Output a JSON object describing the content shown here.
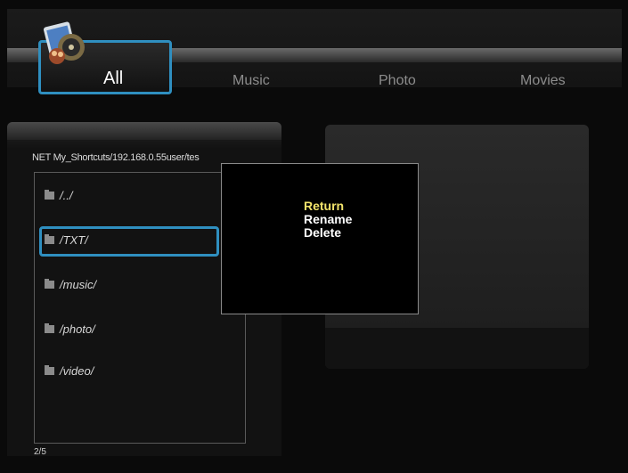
{
  "tabs": [
    {
      "label": "All",
      "active": true
    },
    {
      "label": "Music",
      "active": false
    },
    {
      "label": "Photo",
      "active": false
    },
    {
      "label": "Movies",
      "active": false
    }
  ],
  "browser": {
    "path": "NET My_Shortcuts/192.168.0.55user/tes",
    "items": [
      "/../",
      "/TXT/",
      "/music/",
      "/photo/",
      "/video/"
    ],
    "selected_index": 1,
    "page_count": "2/5"
  },
  "context_menu": {
    "items": [
      "Return",
      "Rename",
      "Delete"
    ],
    "selected_index": 0
  },
  "colors": {
    "focus": "#2f8fc0",
    "selected_text": "#f2e36b",
    "background": "#0a0a0a"
  },
  "icons": [
    "app-media-icon",
    "folder-icon"
  ]
}
